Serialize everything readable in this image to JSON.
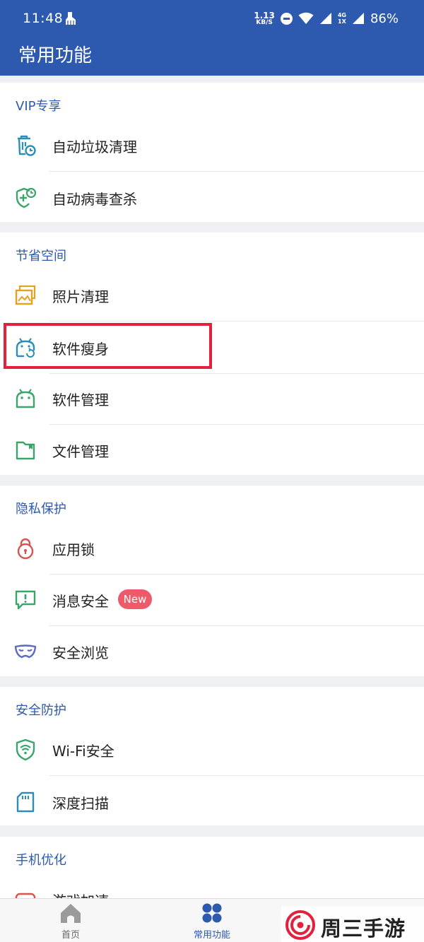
{
  "status_bar": {
    "time": "11:48",
    "speed_value": "1.13",
    "speed_unit": "KB/S",
    "network_top": "4G",
    "network_bottom": "1X",
    "battery": "86%"
  },
  "header": {
    "title": "常用功能"
  },
  "sections": [
    {
      "label": "VIP专享",
      "items": [
        {
          "label": "自动垃圾清理",
          "icon": "trash-clock-icon"
        },
        {
          "label": "自动病毒查杀",
          "icon": "shield-plus-clock-icon"
        }
      ]
    },
    {
      "label": "节省空间",
      "items": [
        {
          "label": "照片清理",
          "icon": "photos-icon"
        },
        {
          "label": "软件瘦身",
          "icon": "android-slim-icon"
        },
        {
          "label": "软件管理",
          "icon": "android-icon"
        },
        {
          "label": "文件管理",
          "icon": "folder-icon"
        }
      ]
    },
    {
      "label": "隐私保护",
      "items": [
        {
          "label": "应用锁",
          "icon": "lock-icon"
        },
        {
          "label": "消息安全",
          "icon": "message-alert-icon",
          "badge": "New"
        },
        {
          "label": "安全浏览",
          "icon": "mask-icon"
        }
      ]
    },
    {
      "label": "安全防护",
      "items": [
        {
          "label": "Wi-Fi安全",
          "icon": "wifi-shield-icon"
        },
        {
          "label": "深度扫描",
          "icon": "sd-card-icon"
        }
      ]
    },
    {
      "label": "手机优化",
      "items": [
        {
          "label": "游戏加速",
          "icon": "game-icon"
        }
      ]
    }
  ],
  "bottom_nav": [
    {
      "label": "首页",
      "icon": "home-icon"
    },
    {
      "label": "常用功能",
      "icon": "four-dots-icon",
      "active": true
    }
  ],
  "watermark": {
    "text": "周三手游网"
  },
  "colors": {
    "brand": "#2d5aaf",
    "highlight": "#e3213d",
    "badge": "#ef5a6a"
  }
}
